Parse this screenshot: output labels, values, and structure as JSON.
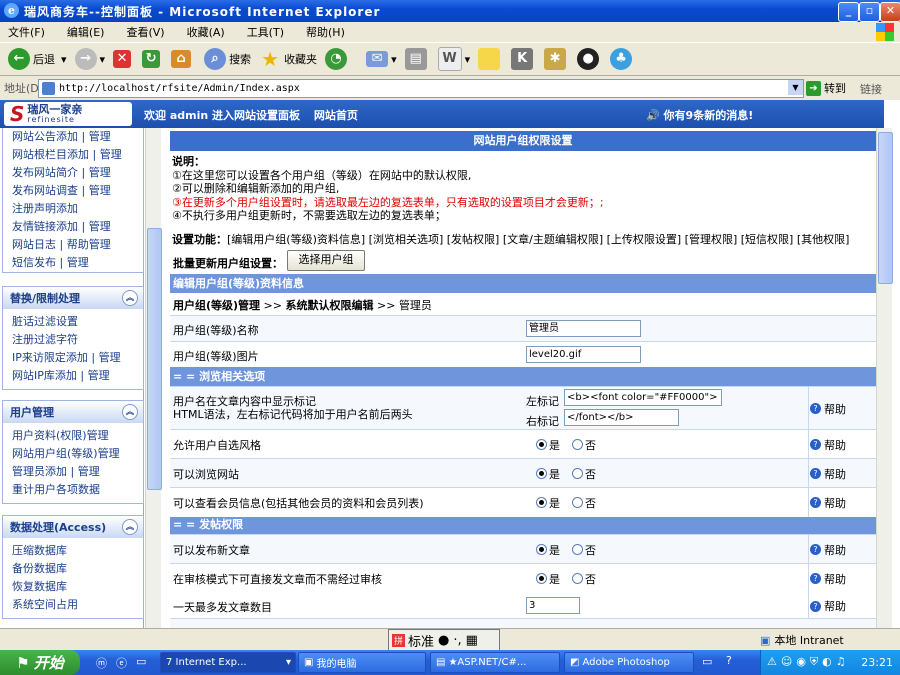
{
  "window": {
    "title": "瑞风商务车--控制面板 - Microsoft Internet Explorer"
  },
  "menu": [
    "文件(F)",
    "编辑(E)",
    "查看(V)",
    "收藏(A)",
    "工具(T)",
    "帮助(H)"
  ],
  "toolbar": {
    "back": "后退",
    "search": "搜索",
    "favorites": "收藏夹"
  },
  "address": {
    "label": "地址(D)",
    "url": "http://localhost/rfsite/Admin/Index.aspx",
    "go": "转到",
    "links": "链接"
  },
  "header": {
    "logo_cn": "瑞风一家亲",
    "logo_en": "refinesite",
    "welcome": "欢迎 admin 进入网站设置面板",
    "home_link": "网站首页",
    "message": "你有9条新的消息!"
  },
  "sidebar": {
    "top_items": [
      "网站公告添加 | 管理",
      "网站根栏目添加 | 管理",
      "发布网站简介 | 管理",
      "发布网站调查 | 管理",
      "注册声明添加",
      "友情链接添加 | 管理",
      "网站日志 | 帮助管理",
      "短信发布 | 管理"
    ],
    "groups": [
      {
        "title": "替换/限制处理",
        "items": [
          "脏话过滤设置",
          "注册过滤字符",
          "IP来访限定添加 | 管理",
          "网站IP库添加 | 管理"
        ]
      },
      {
        "title": "用户管理",
        "items": [
          "用户资料(权限)管理",
          "网站用户组(等级)管理",
          "管理员添加 | 管理",
          "重计用户各项数据"
        ]
      },
      {
        "title": "数据处理(Access)",
        "items": [
          "压缩数据库",
          "备份数据库",
          "恢复数据库",
          "系统空间占用"
        ]
      }
    ]
  },
  "content": {
    "title": "网站用户组权限设置",
    "desc_title": "说明：",
    "desc": [
      "①在这里您可以设置各个用户组（等级）在网站中的默认权限,",
      "②可以删除和编辑新添加的用户组,",
      "③在更新多个用户组设置时，请选取最左边的复选表单，只有选取的设置项目才会更新；;",
      "④不执行多用户组更新时，不需要选取左边的复选表单；"
    ],
    "settings_label": "设置功能：",
    "settings_links": "[编辑用户组(等级)资料信息] [浏览相关选项] [发帖权限] [文章/主题编辑权限] [上传权限设置] [管理权限] [短信权限] [其他权限]",
    "batch_label": "批量更新用户组设置：",
    "batch_button": "选择用户组",
    "section1": "编辑用户组(等级)资料信息",
    "breadcrumb": {
      "a": "用户组(等级)管理",
      "b": "系统默认权限编辑",
      "c": "管理员"
    },
    "name_label": "用户组(等级)名称",
    "name_value": "管理员",
    "img_label": "用户组(等级)图片",
    "img_value": "level20.gif",
    "section2": "= = 浏览相关选项",
    "mark_label1": "用户名在文章内容中显示标记",
    "mark_label2": "HTML语法，左右标记代码将加于用户名前后两头",
    "left_mark_label": "左标记",
    "left_mark_value": "<b><font color=\"#FF0000\">",
    "right_mark_label": "右标记",
    "right_mark_value": "</font></b>",
    "help": "帮助",
    "yes": "是",
    "no": "否",
    "rows_browse": [
      "允许用户自选风格",
      "可以浏览网站",
      "可以查看会员信息(包括其他会员的资料和会员列表)"
    ],
    "section3": "= = 发帖权限",
    "rows_post": [
      "可以发布新文章",
      "在审核模式下可直接发文章而不需经过审核"
    ],
    "daily_label": "一天最多发文章数目",
    "daily_value": "3"
  },
  "status": {
    "ime": "标准",
    "zone": "本地 Intranet"
  },
  "taskbar": {
    "start": "开始",
    "tasks": [
      "7 Internet Exp...",
      "我的电脑",
      "★ASP.NET/C#...",
      "Adobe Photoshop"
    ],
    "clock": "23:21"
  }
}
